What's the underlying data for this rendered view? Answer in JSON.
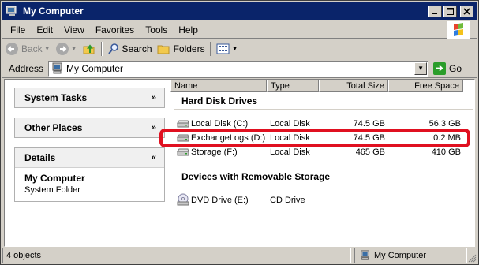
{
  "window": {
    "title": "My Computer"
  },
  "menubar": {
    "items": [
      "File",
      "Edit",
      "View",
      "Favorites",
      "Tools",
      "Help"
    ]
  },
  "toolbar": {
    "back": "Back",
    "search": "Search",
    "folders": "Folders"
  },
  "address": {
    "label": "Address",
    "value": "My Computer",
    "go": "Go"
  },
  "taskpane": {
    "system_tasks": "System Tasks",
    "other_places": "Other Places",
    "details": {
      "title": "Details",
      "name": "My Computer",
      "sub": "System Folder"
    }
  },
  "columns": {
    "name": "Name",
    "type": "Type",
    "total": "Total Size",
    "free": "Free Space"
  },
  "groups": {
    "hard_drives": {
      "title": "Hard Disk Drives",
      "rows": [
        {
          "name": "Local Disk (C:)",
          "type": "Local Disk",
          "total": "74.5 GB",
          "free": "56.3 GB"
        },
        {
          "name": "ExchangeLogs (D:)",
          "type": "Local Disk",
          "total": "74.5 GB",
          "free": "0.2 MB"
        },
        {
          "name": "Storage (F:)",
          "type": "Local Disk",
          "total": "465 GB",
          "free": "410 GB"
        }
      ]
    },
    "removable": {
      "title": "Devices with Removable Storage",
      "rows": [
        {
          "name": "DVD Drive (E:)",
          "type": "CD Drive"
        }
      ]
    }
  },
  "status": {
    "left": "4 objects",
    "right": "My Computer"
  },
  "colors": {
    "title_bar": "#0a246a",
    "highlight": "#e01020",
    "chrome": "#d4d0c8"
  }
}
